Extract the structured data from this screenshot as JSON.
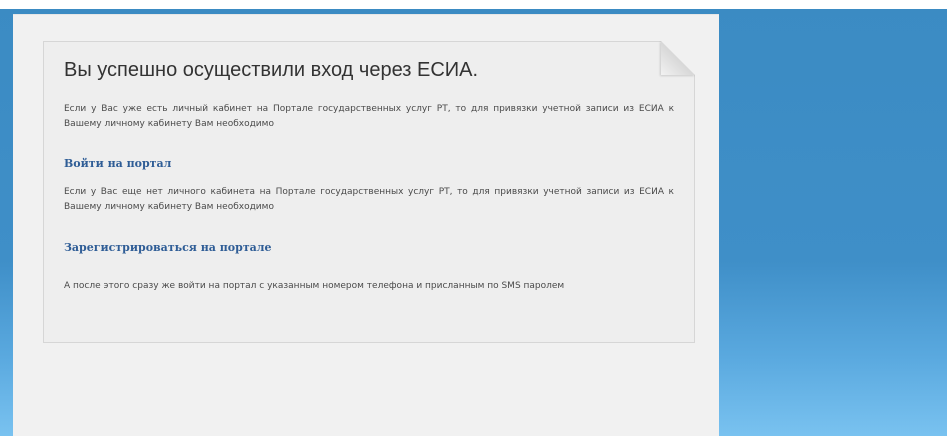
{
  "message_card": {
    "title": "Вы успешно осуществили вход через ЕСИА.",
    "paragraph_1": "Если у Вас уже есть личный кабинет на Портале государственных услуг РТ, то для привязки учетной записи из ЕСИА к Вашему личному кабинету Вам необходимо",
    "login_link": "Войти на портал",
    "paragraph_2": "Если у Вас еще нет личного кабинета на Портале государственных услуг РТ, то для привязки учетной записи из ЕСИА к Вашему личному кабинету Вам необходимо",
    "register_link": "Зарегистрироваться на портале",
    "paragraph_3": "А после этого сразу же войти на портал с указанным номером телефона и присланным по SMS паролем"
  },
  "colors": {
    "background_blue": "#3f8fc8",
    "link_blue": "#2f5d96",
    "panel_gray": "#f1f1f1"
  }
}
